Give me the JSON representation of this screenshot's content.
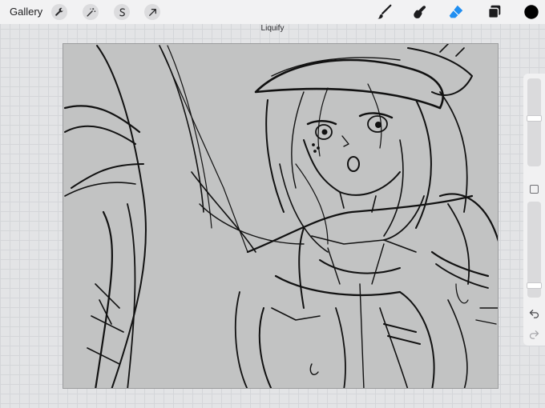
{
  "toolbar": {
    "gallery_label": "Gallery",
    "left_tools": [
      {
        "name": "actions",
        "icon": "wrench-icon"
      },
      {
        "name": "adjustments",
        "icon": "magic-wand-icon"
      },
      {
        "name": "selection",
        "icon": "selection-s-icon"
      },
      {
        "name": "transform",
        "icon": "arrow-cursor-icon"
      }
    ],
    "right_tools": [
      {
        "name": "brush",
        "icon": "brush-icon"
      },
      {
        "name": "smudge",
        "icon": "smudge-finger-icon"
      },
      {
        "name": "eraser",
        "icon": "eraser-icon",
        "active": true
      },
      {
        "name": "layers",
        "icon": "layers-icon"
      },
      {
        "name": "color",
        "icon": "color-swatch",
        "value": "#000000"
      }
    ]
  },
  "mode_label": "Liquify",
  "sidebar": {
    "brush_size_level": 0.55,
    "opacity_level": 0.1,
    "undo_icon": "undo-icon",
    "redo_icon": "redo-icon"
  },
  "colors": {
    "accent": "#1f8ef1",
    "canvas_bg": "#c2c3c3",
    "stroke": "#111111"
  }
}
